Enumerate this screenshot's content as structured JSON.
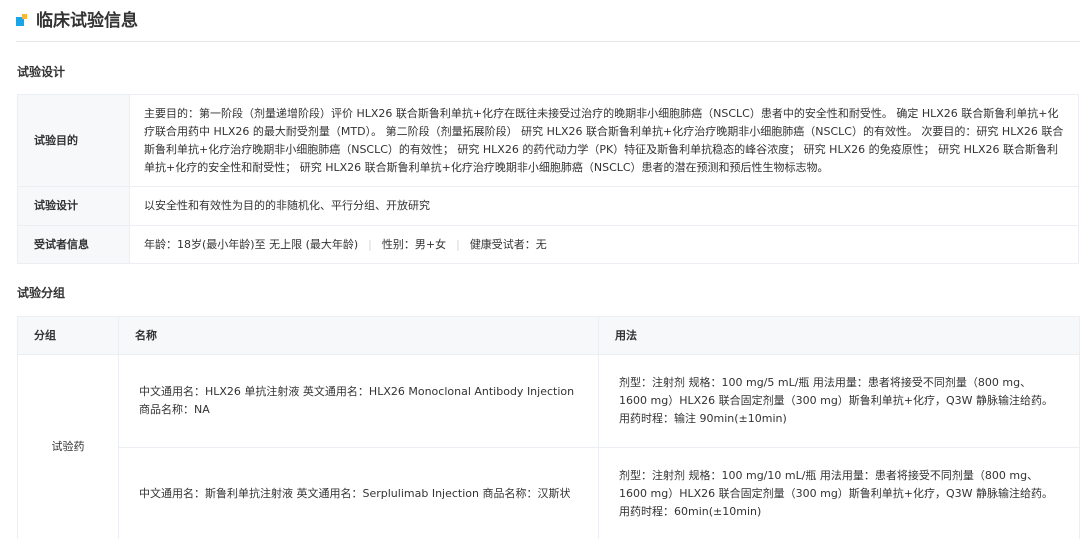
{
  "header": {
    "title": "临床试验信息"
  },
  "design_section": {
    "title": "试验设计",
    "rows": [
      {
        "label": "试验目的",
        "value": "主要目的：第一阶段（剂量递增阶段）评价 HLX26 联合斯鲁利单抗+化疗在既往未接受过治疗的晚期非小细胞肺癌（NSCLC）患者中的安全性和耐受性。 确定 HLX26 联合斯鲁利单抗+化疗联合用药中 HLX26 的最大耐受剂量（MTD）。 第二阶段（剂量拓展阶段） 研究 HLX26 联合斯鲁利单抗+化疗治疗晚期非小细胞肺癌（NSCLC）的有效性。 次要目的：研究 HLX26 联合斯鲁利单抗+化疗治疗晚期非小细胞肺癌（NSCLC）的有效性； 研究 HLX26 的药代动力学（PK）特征及斯鲁利单抗稳态的峰谷浓度； 研究 HLX26 的免疫原性； 研究 HLX26 联合斯鲁利单抗+化疗的安全性和耐受性； 研究 HLX26 联合斯鲁利单抗+化疗治疗晚期非小细胞肺癌（NSCLC）患者的潜在预测和预后性生物标志物。"
      },
      {
        "label": "试验设计",
        "value": "以安全性和有效性为目的的非随机化、平行分组、开放研究"
      },
      {
        "label": "受试者信息",
        "age": "年龄：18岁(最小年龄)至 无上限 (最大年龄)",
        "sex": "性别：男+女",
        "healthy": "健康受试者：无"
      }
    ]
  },
  "groups_section": {
    "title": "试验分组",
    "columns": [
      "分组",
      "名称",
      "用法"
    ],
    "group_label": "试验药",
    "rows": [
      {
        "name": "中文通用名：HLX26 单抗注射液 英文通用名：HLX26 Monoclonal Antibody Injection 商品名称：NA",
        "usage": "剂型：注射剂 规格：100 mg/5 mL/瓶 用法用量：患者将接受不同剂量（800 mg、1600 mg）HLX26 联合固定剂量（300 mg）斯鲁利单抗+化疗，Q3W 静脉输注给药。 用药时程：输注 90min(±10min)"
      },
      {
        "name": "中文通用名：斯鲁利单抗注射液 英文通用名：Serplulimab Injection 商品名称：汉斯状",
        "usage": "剂型：注射剂 规格：100 mg/10 mL/瓶 用法用量：患者将接受不同剂量（800 mg、1600 mg）HLX26 联合固定剂量（300 mg）斯鲁利单抗+化疗，Q3W 静脉输注给药。 用药时程：60min(±10min)"
      }
    ]
  }
}
